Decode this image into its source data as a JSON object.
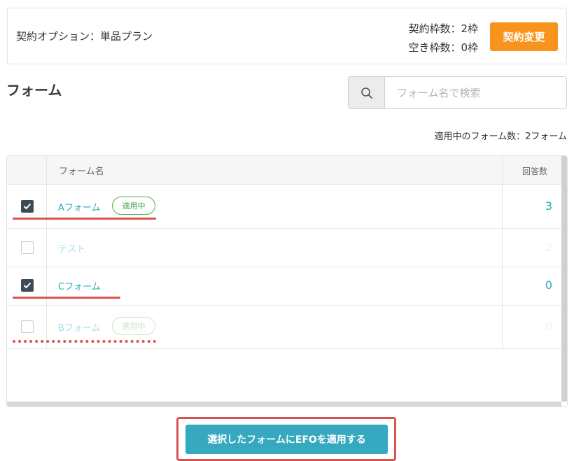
{
  "contract": {
    "option_label": "契約オプション：単品プラン",
    "slots_total": "契約枠数：2枠",
    "slots_free": "空き枠数：0枠",
    "change_button": "契約変更",
    "accent_color": "#f7941d"
  },
  "forms_section": {
    "title": "フォーム",
    "search_placeholder": "フォーム名で検索",
    "search_icon": "search-icon",
    "applied_count_text": "適用中のフォーム数：2フォーム"
  },
  "table": {
    "columns": [
      "フォーム名",
      "回答数"
    ],
    "rows": [
      {
        "checked": true,
        "name": "Aフォーム",
        "badge": "適用中",
        "count": "3",
        "faded": false
      },
      {
        "checked": false,
        "name": "テスト",
        "badge": "",
        "count": "2",
        "faded": true
      },
      {
        "checked": true,
        "name": "Cフォーム",
        "badge": "",
        "count": "0",
        "faded": false
      },
      {
        "checked": false,
        "name": "Bフォーム",
        "badge": "適用中",
        "count": "0",
        "faded": true
      }
    ]
  },
  "apply_button": {
    "label": "選択したフォームにEFOを適用する",
    "color": "#36a9c1",
    "highlight_color": "#d9534f"
  }
}
